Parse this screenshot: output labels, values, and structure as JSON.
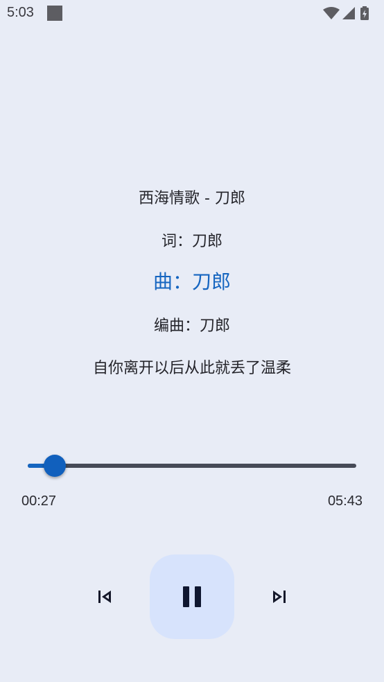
{
  "status_bar": {
    "time": "5:03",
    "icons": [
      "notification-square-icon",
      "wifi-icon",
      "signal-icon",
      "battery-charging-icon"
    ]
  },
  "lyrics": {
    "lines": [
      {
        "text": "西海情歌 - 刀郎",
        "active": false
      },
      {
        "text": "词：刀郎",
        "active": false
      },
      {
        "text": "曲：刀郎",
        "active": true
      },
      {
        "text": "编曲：刀郎",
        "active": false
      },
      {
        "text": "自你离开以后从此就丢了温柔",
        "active": false
      }
    ]
  },
  "player": {
    "current_time": "00:27",
    "total_time": "05:43",
    "progress_fraction": 0.083
  },
  "controls": {
    "previous_icon": "skip-previous-icon",
    "play_pause_icon": "pause-icon",
    "next_icon": "skip-next-icon"
  },
  "colors": {
    "background": "#e8ecf6",
    "accent": "#1565c0",
    "play_button_bg": "#d7e3fc",
    "track": "#464a57"
  }
}
